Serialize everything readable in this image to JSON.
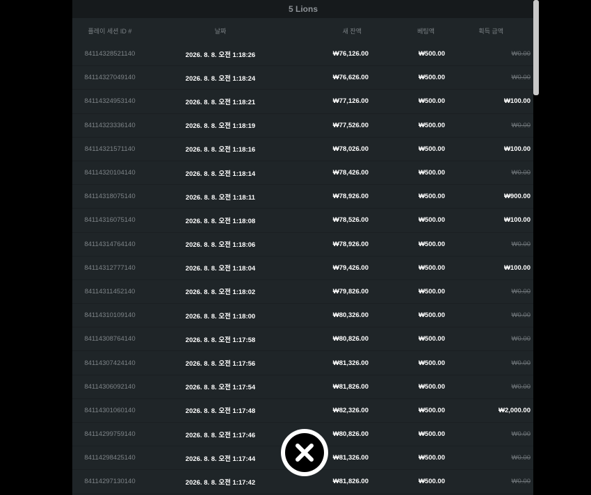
{
  "title": "5 Lions",
  "columns": {
    "id": "플레이 세션 ID #",
    "date": "날짜",
    "balance": "새 잔액",
    "bet": "베팅액",
    "win": "획득 금액"
  },
  "rows": [
    {
      "id": "84114328521140",
      "date": "2026. 8. 8. 오전 1:18:26",
      "balance": "₩76,126.00",
      "bet": "₩500.00",
      "win": "₩0.00",
      "zero": true
    },
    {
      "id": "84114327049140",
      "date": "2026. 8. 8. 오전 1:18:24",
      "balance": "₩76,626.00",
      "bet": "₩500.00",
      "win": "₩0.00",
      "zero": true
    },
    {
      "id": "84114324953140",
      "date": "2026. 8. 8. 오전 1:18:21",
      "balance": "₩77,126.00",
      "bet": "₩500.00",
      "win": "₩100.00",
      "zero": false
    },
    {
      "id": "84114323336140",
      "date": "2026. 8. 8. 오전 1:18:19",
      "balance": "₩77,526.00",
      "bet": "₩500.00",
      "win": "₩0.00",
      "zero": true
    },
    {
      "id": "84114321571140",
      "date": "2026. 8. 8. 오전 1:18:16",
      "balance": "₩78,026.00",
      "bet": "₩500.00",
      "win": "₩100.00",
      "zero": false
    },
    {
      "id": "84114320104140",
      "date": "2026. 8. 8. 오전 1:18:14",
      "balance": "₩78,426.00",
      "bet": "₩500.00",
      "win": "₩0.00",
      "zero": true
    },
    {
      "id": "84114318075140",
      "date": "2026. 8. 8. 오전 1:18:11",
      "balance": "₩78,926.00",
      "bet": "₩500.00",
      "win": "₩900.00",
      "zero": false
    },
    {
      "id": "84114316075140",
      "date": "2026. 8. 8. 오전 1:18:08",
      "balance": "₩78,526.00",
      "bet": "₩500.00",
      "win": "₩100.00",
      "zero": false
    },
    {
      "id": "84114314764140",
      "date": "2026. 8. 8. 오전 1:18:06",
      "balance": "₩78,926.00",
      "bet": "₩500.00",
      "win": "₩0.00",
      "zero": true
    },
    {
      "id": "84114312777140",
      "date": "2026. 8. 8. 오전 1:18:04",
      "balance": "₩79,426.00",
      "bet": "₩500.00",
      "win": "₩100.00",
      "zero": false
    },
    {
      "id": "84114311452140",
      "date": "2026. 8. 8. 오전 1:18:02",
      "balance": "₩79,826.00",
      "bet": "₩500.00",
      "win": "₩0.00",
      "zero": true
    },
    {
      "id": "84114310109140",
      "date": "2026. 8. 8. 오전 1:18:00",
      "balance": "₩80,326.00",
      "bet": "₩500.00",
      "win": "₩0.00",
      "zero": true
    },
    {
      "id": "84114308764140",
      "date": "2026. 8. 8. 오전 1:17:58",
      "balance": "₩80,826.00",
      "bet": "₩500.00",
      "win": "₩0.00",
      "zero": true
    },
    {
      "id": "84114307424140",
      "date": "2026. 8. 8. 오전 1:17:56",
      "balance": "₩81,326.00",
      "bet": "₩500.00",
      "win": "₩0.00",
      "zero": true
    },
    {
      "id": "84114306092140",
      "date": "2026. 8. 8. 오전 1:17:54",
      "balance": "₩81,826.00",
      "bet": "₩500.00",
      "win": "₩0.00",
      "zero": true
    },
    {
      "id": "84114301060140",
      "date": "2026. 8. 8. 오전 1:17:48",
      "balance": "₩82,326.00",
      "bet": "₩500.00",
      "win": "₩2,000.00",
      "zero": false
    },
    {
      "id": "84114299759140",
      "date": "2026. 8. 8. 오전 1:17:46",
      "balance": "₩80,826.00",
      "bet": "₩500.00",
      "win": "₩0.00",
      "zero": true
    },
    {
      "id": "84114298425140",
      "date": "2026. 8. 8. 오전 1:17:44",
      "balance": "₩81,326.00",
      "bet": "₩500.00",
      "win": "₩0.00",
      "zero": true
    },
    {
      "id": "84114297130140",
      "date": "2026. 8. 8. 오전 1:17:42",
      "balance": "₩81,826.00",
      "bet": "₩500.00",
      "win": "₩0.00",
      "zero": true
    }
  ],
  "close_icon": "close-icon",
  "colors": {
    "background": "#000000",
    "panel": "#1f2528",
    "title_bar": "#161a1c",
    "muted_text": "#7e8488",
    "strong_text": "#ffffff"
  }
}
